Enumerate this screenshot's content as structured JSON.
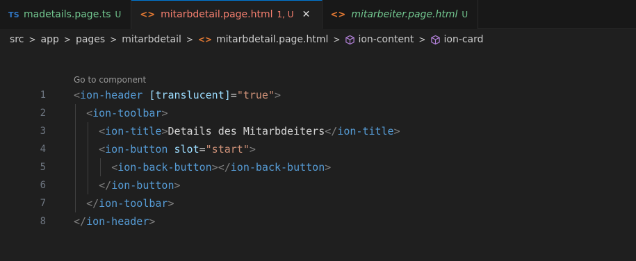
{
  "tabs": [
    {
      "prefix": "TS",
      "name": "madetails.page.ts",
      "badge": "U",
      "active": false
    },
    {
      "prefix": "<>",
      "name": "mitarbdetail.page.html",
      "badge": "1, U",
      "active": true,
      "close": "✕"
    },
    {
      "prefix": "<>",
      "name": "mitarbeiter.page.html",
      "badge": "U",
      "active": false
    }
  ],
  "breadcrumb": {
    "items": [
      "src",
      "app",
      "pages",
      "mitarbdetail",
      "mitarbdetail.page.html",
      "ion-content",
      "ion-card"
    ],
    "separator": ">"
  },
  "editor": {
    "codelens": "Go to component",
    "line_numbers": [
      "1",
      "2",
      "3",
      "4",
      "5",
      "6",
      "7",
      "8"
    ],
    "lines": [
      {
        "indent": "",
        "tokens": [
          [
            "b",
            "<"
          ],
          [
            "t",
            "ion-header"
          ],
          [
            "x",
            " "
          ],
          [
            "a",
            "[translucent]"
          ],
          [
            "x",
            "="
          ],
          [
            "s",
            "\"true\""
          ],
          [
            "b",
            ">"
          ]
        ]
      },
      {
        "indent": "  ",
        "tokens": [
          [
            "b",
            "<"
          ],
          [
            "t",
            "ion-toolbar"
          ],
          [
            "b",
            ">"
          ]
        ]
      },
      {
        "indent": "    ",
        "tokens": [
          [
            "b",
            "<"
          ],
          [
            "t",
            "ion-title"
          ],
          [
            "b",
            ">"
          ],
          [
            "x",
            "Details des Mitarbdeiters"
          ],
          [
            "b",
            "</"
          ],
          [
            "t",
            "ion-title"
          ],
          [
            "b",
            ">"
          ]
        ]
      },
      {
        "indent": "    ",
        "tokens": [
          [
            "b",
            "<"
          ],
          [
            "t",
            "ion-button"
          ],
          [
            "x",
            " "
          ],
          [
            "a",
            "slot"
          ],
          [
            "x",
            "="
          ],
          [
            "s",
            "\"start\""
          ],
          [
            "b",
            ">"
          ]
        ]
      },
      {
        "indent": "      ",
        "tokens": [
          [
            "b",
            "<"
          ],
          [
            "t",
            "ion-back-button"
          ],
          [
            "b",
            "></"
          ],
          [
            "t",
            "ion-back-button"
          ],
          [
            "b",
            ">"
          ]
        ]
      },
      {
        "indent": "    ",
        "tokens": [
          [
            "b",
            "</"
          ],
          [
            "t",
            "ion-button"
          ],
          [
            "b",
            ">"
          ]
        ]
      },
      {
        "indent": "  ",
        "tokens": [
          [
            "b",
            "</"
          ],
          [
            "t",
            "ion-toolbar"
          ],
          [
            "b",
            ">"
          ]
        ]
      },
      {
        "indent": "",
        "tokens": [
          [
            "b",
            "</"
          ],
          [
            "t",
            "ion-header"
          ],
          [
            "b",
            ">"
          ]
        ]
      }
    ]
  },
  "colors": {
    "accent": "#0078d4",
    "untracked_green": "#73c991",
    "error_red": "#f88070",
    "html_icon": "#e37933",
    "ts_icon": "#3178c6"
  },
  "icons": [
    "typescript-file-icon",
    "html-file-icon",
    "close-icon",
    "chevron-right-icon",
    "symbol-component-icon"
  ]
}
